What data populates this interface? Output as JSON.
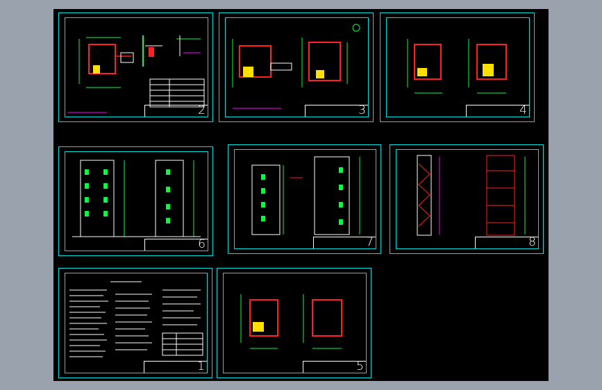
{
  "sheets": [
    {
      "id": "sheet-2",
      "number": "2"
    },
    {
      "id": "sheet-3",
      "number": "3"
    },
    {
      "id": "sheet-4",
      "number": "4"
    },
    {
      "id": "sheet-6",
      "number": "6"
    },
    {
      "id": "sheet-7",
      "number": "7"
    },
    {
      "id": "sheet-8",
      "number": "8"
    },
    {
      "id": "sheet-1",
      "number": "1"
    },
    {
      "id": "sheet-5",
      "number": "5"
    }
  ],
  "colors": {
    "background": "#000000",
    "frame": "#00e0e0",
    "wall": "#ff2020",
    "line": "#ffffff",
    "dimension": "#00ff40",
    "accent": "#ffff00",
    "note": "#ff00ff"
  }
}
